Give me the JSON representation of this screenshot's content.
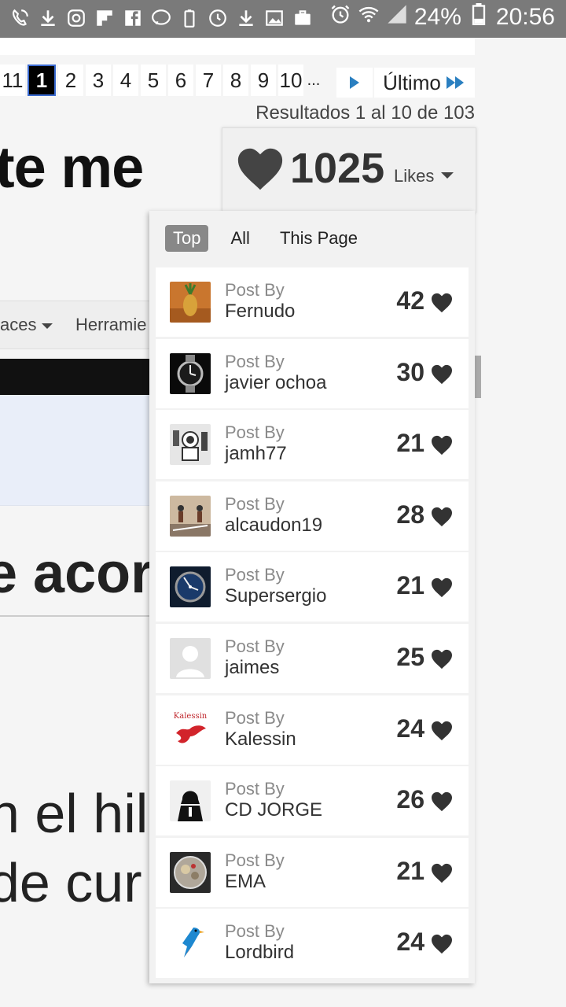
{
  "status_bar": {
    "battery": "24%",
    "time": "20:56",
    "left_icons": [
      "phone-wifi-icon",
      "download-icon",
      "instagram-icon",
      "flipboard-icon",
      "facebook-icon",
      "bbva-icon",
      "battery-saver-icon",
      "sync-icon",
      "download-icon",
      "image-icon",
      "briefcase-icon"
    ],
    "right_icons": [
      "alarm-icon",
      "wifi-icon",
      "signal-icon",
      "battery-icon"
    ]
  },
  "pagination": {
    "pages": [
      "11",
      "1",
      "2",
      "3",
      "4",
      "5",
      "6",
      "7",
      "8",
      "9",
      "10",
      "..."
    ],
    "active_page": "1",
    "last_label": "Último",
    "results_text": "Resultados 1 al 10 de 103"
  },
  "background": {
    "title_fragment": "te me",
    "nav_left": "aces",
    "nav_right": "Herramie",
    "heading_fragment": "e acor",
    "body_line1": "n el hil",
    "body_line2": "de cur"
  },
  "likes": {
    "count": "1025",
    "label": "Likes"
  },
  "tabs": [
    "Top",
    "All",
    "This Page"
  ],
  "active_tab": "Top",
  "colors": {
    "accent_blue": "#2a7fc0",
    "heart": "#333333",
    "active_tab_bg": "#888888"
  },
  "posts": [
    {
      "post_by": "Post By",
      "user": "Fernudo",
      "likes": "42",
      "avatar": "pineapple-avatar"
    },
    {
      "post_by": "Post By",
      "user": "javier ochoa",
      "likes": "30",
      "avatar": "watch-avatar"
    },
    {
      "post_by": "Post By",
      "user": "jamh77",
      "likes": "21",
      "avatar": "astronaut-avatar"
    },
    {
      "post_by": "Post By",
      "user": "alcaudon19",
      "likes": "28",
      "avatar": "figures-avatar"
    },
    {
      "post_by": "Post By",
      "user": "Supersergio",
      "likes": "21",
      "avatar": "dive-watch-avatar"
    },
    {
      "post_by": "Post By",
      "user": "jaimes",
      "likes": "25",
      "avatar": "default-avatar"
    },
    {
      "post_by": "Post By",
      "user": "Kalessin",
      "likes": "24",
      "avatar": "kalessin-logo-avatar",
      "avatar_text": "Kalessin"
    },
    {
      "post_by": "Post By",
      "user": "CD JORGE",
      "likes": "26",
      "avatar": "vader-avatar"
    },
    {
      "post_by": "Post By",
      "user": "EMA",
      "likes": "21",
      "avatar": "movement-avatar"
    },
    {
      "post_by": "Post By",
      "user": "Lordbird",
      "likes": "24",
      "avatar": "bird-avatar"
    }
  ]
}
